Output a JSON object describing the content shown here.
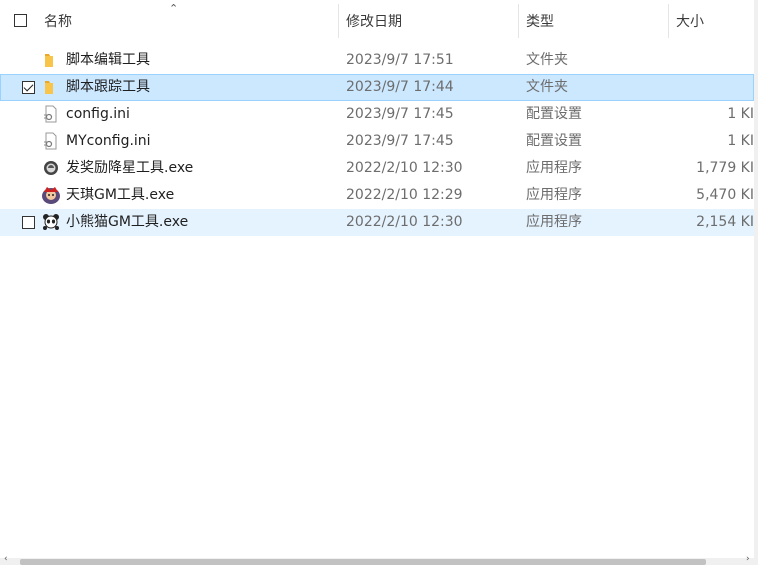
{
  "header": {
    "name": "名称",
    "date": "修改日期",
    "type": "类型",
    "size": "大小"
  },
  "files": [
    {
      "name": "脚本编辑工具",
      "date": "2023/9/7 17:51",
      "type": "文件夹",
      "size": "",
      "icon": "folder-icon",
      "state": "normal"
    },
    {
      "name": "脚本跟踪工具",
      "date": "2023/9/7 17:44",
      "type": "文件夹",
      "size": "",
      "icon": "folder-icon",
      "state": "selected",
      "checked": true
    },
    {
      "name": "config.ini",
      "date": "2023/9/7 17:45",
      "type": "配置设置",
      "size": "1 KI",
      "icon": "ini-file-icon",
      "state": "normal"
    },
    {
      "name": "MYconfig.ini",
      "date": "2023/9/7 17:45",
      "type": "配置设置",
      "size": "1 KI",
      "icon": "ini-file-icon",
      "state": "normal"
    },
    {
      "name": "发奖励降星工具.exe",
      "date": "2022/2/10 12:30",
      "type": "应用程序",
      "size": "1,779 KI",
      "icon": "app-circle-icon",
      "state": "normal"
    },
    {
      "name": "天琪GM工具.exe",
      "date": "2022/2/10 12:29",
      "type": "应用程序",
      "size": "5,470 KI",
      "icon": "app-character-icon",
      "state": "normal"
    },
    {
      "name": "小熊猫GM工具.exe",
      "date": "2022/2/10 12:30",
      "type": "应用程序",
      "size": "2,154 KI",
      "icon": "panda-app-icon",
      "state": "hover",
      "checked": false
    }
  ],
  "colors": {
    "selected_bg": "#cce8ff",
    "hover_bg": "#e5f3ff",
    "folder": "#f8c44a"
  }
}
